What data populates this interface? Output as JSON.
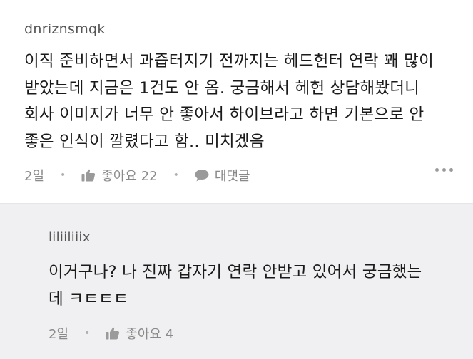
{
  "post": {
    "author": "dnriznsmqk",
    "text": "이직 준비하면서 과즙터지기 전까지는 헤드헌터 연락 꽤 많이\n받았는데 지금은 1건도 안 옴. 궁금해서 헤헌 상담해봤더니\n회사 이미지가 너무 안 좋아서 하이브라고 하면 기본으로 안\n좋은 인식이 깔렸다고 함.. 미치겠음",
    "time": "2일",
    "like_label": "좋아요 22",
    "reply_label": "대댓글"
  },
  "reply": {
    "author": "liliiliiix",
    "text": "이거구나? 나 진짜 갑자기 연락 안받고 있어서 궁금했는\n데 ㅋㅌㅌㅌ",
    "time": "2일",
    "like_label": "좋아요 4"
  }
}
